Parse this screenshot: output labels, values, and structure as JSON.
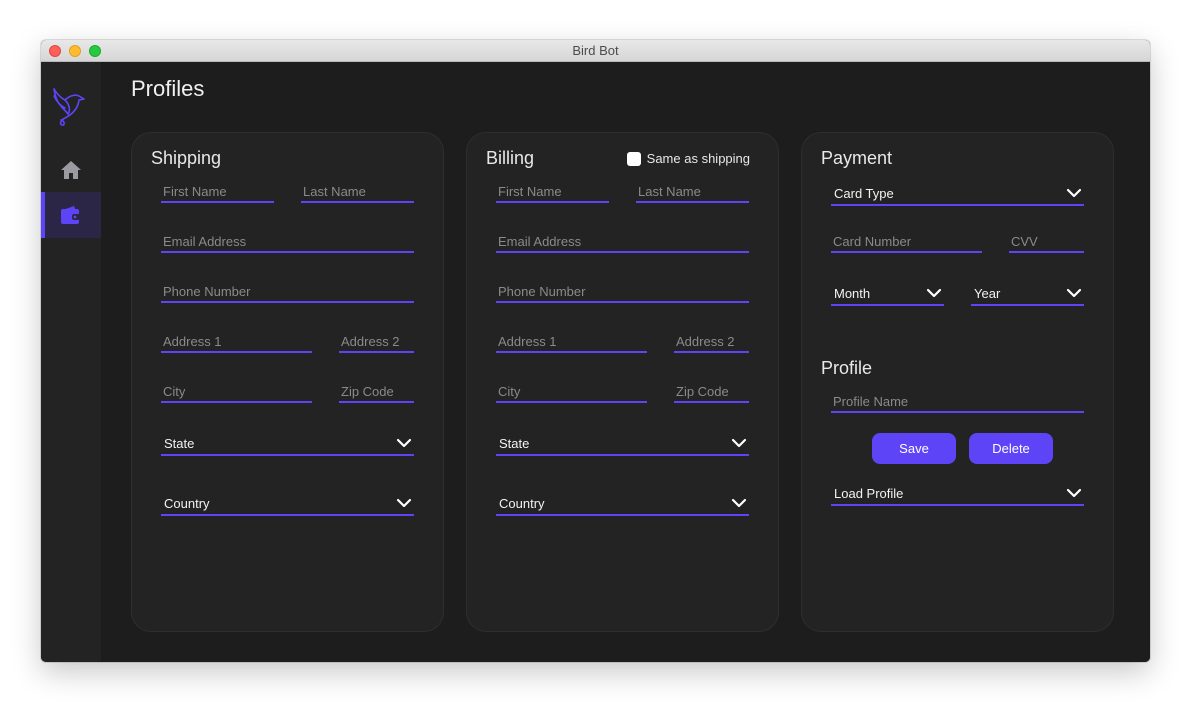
{
  "window": {
    "title": "Bird Bot"
  },
  "sidebar": {
    "items": [
      {
        "name": "home",
        "icon": "home-icon",
        "active": false
      },
      {
        "name": "profiles",
        "icon": "wallet-icon",
        "active": true
      }
    ],
    "accent": "#5d45f7"
  },
  "page": {
    "title": "Profiles"
  },
  "shipping": {
    "title": "Shipping",
    "first_name": {
      "placeholder": "First Name",
      "value": ""
    },
    "last_name": {
      "placeholder": "Last Name",
      "value": ""
    },
    "email": {
      "placeholder": "Email Address",
      "value": ""
    },
    "phone": {
      "placeholder": "Phone Number",
      "value": ""
    },
    "address1": {
      "placeholder": "Address 1",
      "value": ""
    },
    "address2": {
      "placeholder": "Address 2",
      "value": ""
    },
    "city": {
      "placeholder": "City",
      "value": ""
    },
    "zip": {
      "placeholder": "Zip Code",
      "value": ""
    },
    "state": {
      "selected": "State"
    },
    "country": {
      "selected": "Country"
    }
  },
  "billing": {
    "title": "Billing",
    "same_as_shipping": {
      "label": "Same as shipping",
      "checked": false
    },
    "first_name": {
      "placeholder": "First Name",
      "value": ""
    },
    "last_name": {
      "placeholder": "Last Name",
      "value": ""
    },
    "email": {
      "placeholder": "Email Address",
      "value": ""
    },
    "phone": {
      "placeholder": "Phone Number",
      "value": ""
    },
    "address1": {
      "placeholder": "Address 1",
      "value": ""
    },
    "address2": {
      "placeholder": "Address 2",
      "value": ""
    },
    "city": {
      "placeholder": "City",
      "value": ""
    },
    "zip": {
      "placeholder": "Zip Code",
      "value": ""
    },
    "state": {
      "selected": "State"
    },
    "country": {
      "selected": "Country"
    }
  },
  "payment": {
    "title": "Payment",
    "card_type": {
      "selected": "Card Type"
    },
    "card_number": {
      "placeholder": "Card Number",
      "value": ""
    },
    "cvv": {
      "placeholder": "CVV",
      "value": ""
    },
    "month": {
      "selected": "Month"
    },
    "year": {
      "selected": "Year"
    }
  },
  "profile": {
    "title": "Profile",
    "profile_name": {
      "placeholder": "Profile Name",
      "value": ""
    },
    "save_label": "Save",
    "delete_label": "Delete",
    "load_profile": {
      "selected": "Load Profile"
    }
  }
}
